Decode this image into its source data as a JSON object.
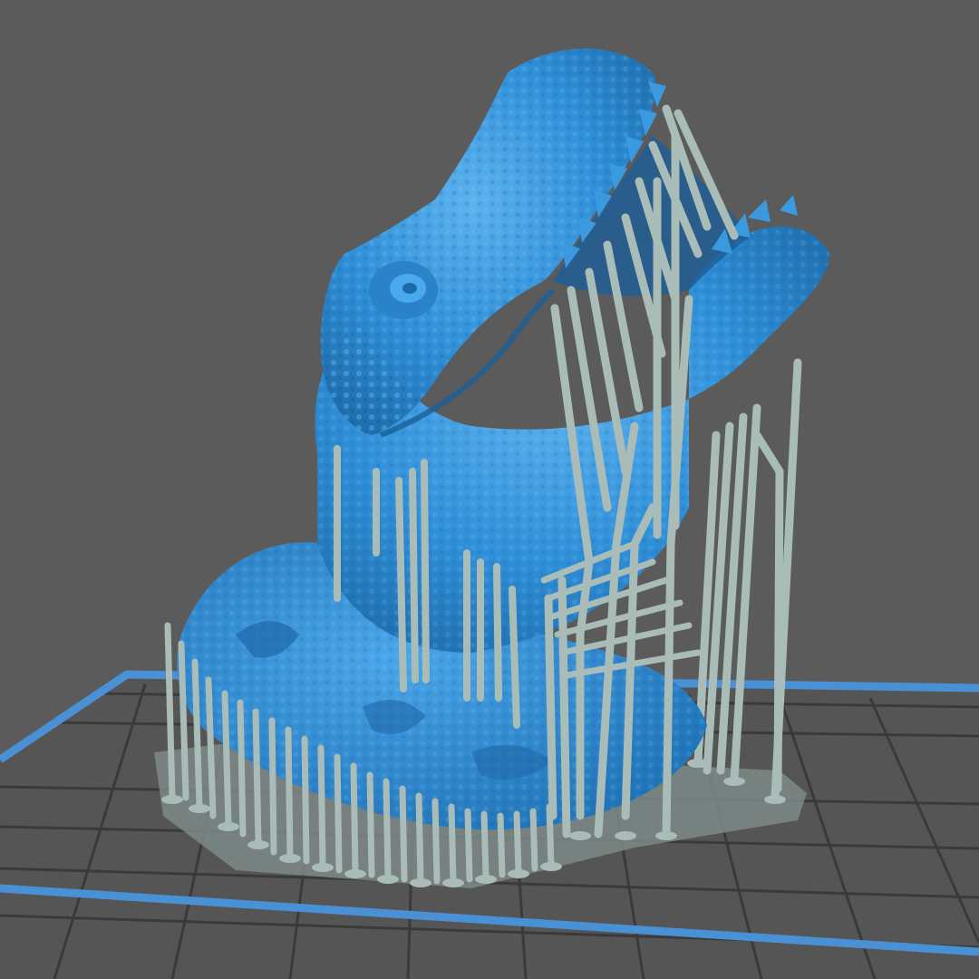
{
  "viewport": {
    "background_color": "#5b5b5b",
    "build_plate": {
      "border_color": "#4a90d4",
      "grid_color": "#383838",
      "fill_color": "#555555"
    },
    "model": {
      "subject": "t-rex-bust",
      "color": "#2f8fd8",
      "highlight_color": "#66b8f2",
      "shadow_color": "#1f6fb0"
    },
    "supports": {
      "color": "#a9bcb8",
      "shadow_color": "#7f928e",
      "raft_color": "#7e8a87"
    }
  }
}
